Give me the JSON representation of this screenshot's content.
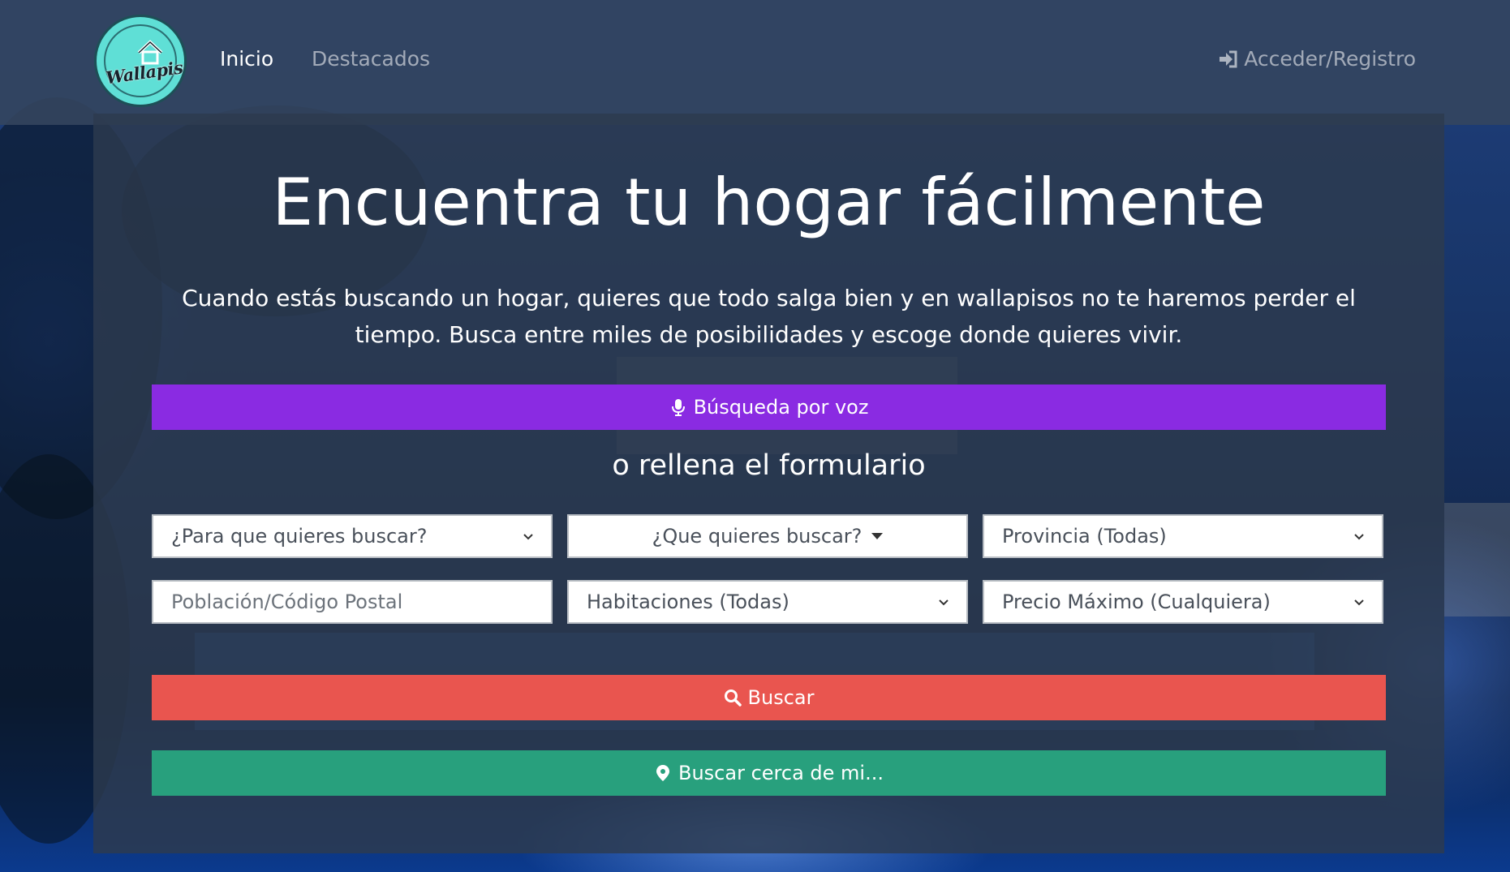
{
  "nav": {
    "logo_text": "Wallapisos",
    "links": [
      {
        "label": "Inicio",
        "active": true
      },
      {
        "label": "Destacados",
        "active": false
      }
    ],
    "login_label": "Acceder/Registro",
    "login_icon": "sign-in-icon"
  },
  "hero": {
    "title": "Encuentra tu hogar fácilmente",
    "description": "Cuando estás buscando un hogar, quieres que todo salga bien y en wallapisos no te haremos perder el tiempo. Busca entre miles de posibilidades y escoge donde quieres vivir.",
    "voice_button": {
      "label": "Búsqueda por voz",
      "icon": "microphone-icon",
      "color": "#8a2be2"
    },
    "subheading": "o rellena el formulario",
    "form": {
      "purpose_select": "¿Para que quieres buscar?",
      "type_dropdown": "¿Que quieres buscar?",
      "province_select": "Provincia (Todas)",
      "location_placeholder": "Población/Código Postal",
      "rooms_select": "Habitaciones (Todas)",
      "max_price_select": "Precio Máximo (Cualquiera)"
    },
    "search_button": {
      "label": "Buscar",
      "icon": "search-icon",
      "color": "#e9554f"
    },
    "nearby_button": {
      "label": "Buscar cerca de mi...",
      "icon": "map-marker-icon",
      "color": "#28a07d"
    }
  },
  "colors": {
    "navbar": "#34465f",
    "panel": "#2d3a4e",
    "logo": "#5fdfd6"
  }
}
